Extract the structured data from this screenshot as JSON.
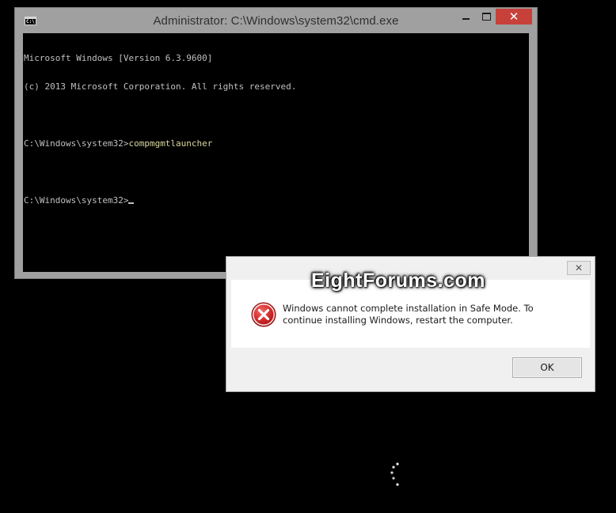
{
  "cmd_window": {
    "title": "Administrator: C:\\Windows\\system32\\cmd.exe",
    "icon_label": "C:\\",
    "icon": "console-icon",
    "close_color": "#c7413a",
    "lines": {
      "version": "Microsoft Windows [Version 6.3.9600]",
      "copyright": "(c) 2013 Microsoft Corporation. All rights reserved.",
      "prompt1": "C:\\Windows\\system32>",
      "command1": "compmgmtlauncher",
      "prompt2": "C:\\Windows\\system32>"
    }
  },
  "watermark": {
    "text": "EightForums.com"
  },
  "dialog": {
    "close_label": "✕",
    "icon": "error-icon",
    "icon_color": "#d42a2a",
    "message": "Windows cannot complete installation in Safe Mode. To continue installing Windows, restart the computer.",
    "ok_label": "OK"
  },
  "spinner": {
    "icon": "loading-spinner-icon"
  }
}
